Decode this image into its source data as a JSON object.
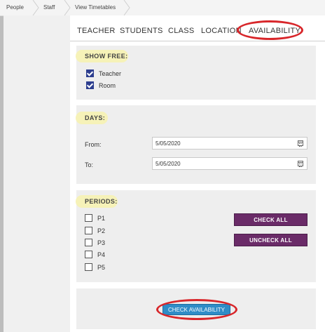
{
  "breadcrumb": {
    "items": [
      "People",
      "Staff",
      "View Timetables"
    ]
  },
  "tabs": [
    "TEACHER",
    "STUDENTS",
    "CLASS",
    "LOCATION",
    "AVAILABILITY"
  ],
  "show_free": {
    "title": "SHOW FREE:",
    "options": [
      {
        "label": "Teacher",
        "checked": true
      },
      {
        "label": "Room",
        "checked": true
      }
    ]
  },
  "days": {
    "title": "DAYS:",
    "from_label": "From:",
    "from_value": "5/05/2020",
    "to_label": "To:",
    "to_value": "5/05/2020"
  },
  "periods": {
    "title": "PERIODS:",
    "items": [
      "P1",
      "P2",
      "P3",
      "P4",
      "P5"
    ],
    "check_all": "CHECK ALL",
    "uncheck_all": "UNCHECK ALL"
  },
  "actions": {
    "check_availability": "CHECK AVAILABILITY"
  },
  "colors": {
    "accent_purple": "#6a2b68",
    "accent_blue": "#2f8cc7",
    "highlight_ring": "#d8262a",
    "highlight_marker": "#f6f2b8"
  }
}
